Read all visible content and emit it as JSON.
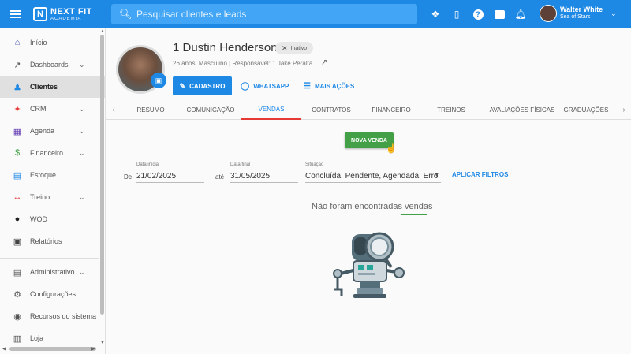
{
  "topbar": {
    "logo_line1": "NEXT FIT",
    "logo_line2": "ACADEMIA",
    "search_placeholder": "Pesquisar clientes e leads",
    "icons": [
      "gift-icon",
      "phone-icon",
      "help-icon",
      "chat-icon",
      "bell-icon"
    ],
    "user_name": "Walter White",
    "user_subtitle": "Sea of Stars"
  },
  "sidebar": {
    "items": [
      {
        "label": "Início",
        "icon": "home-icon"
      },
      {
        "label": "Dashboards",
        "icon": "chart-icon",
        "expandable": true
      },
      {
        "label": "Clientes",
        "icon": "people-icon",
        "active": true
      },
      {
        "label": "CRM",
        "icon": "crm-icon",
        "expandable": true
      },
      {
        "label": "Agenda",
        "icon": "calendar-icon",
        "expandable": true
      },
      {
        "label": "Financeiro",
        "icon": "money-icon",
        "expandable": true
      },
      {
        "label": "Estoque",
        "icon": "cart-icon"
      },
      {
        "label": "Treino",
        "icon": "dumbbell-icon",
        "expandable": true
      },
      {
        "label": "WOD",
        "icon": "kettlebell-icon"
      },
      {
        "label": "Relatórios",
        "icon": "report-icon"
      }
    ],
    "items2": [
      {
        "label": "Administrativo",
        "icon": "admin-icon",
        "expandable": true
      },
      {
        "label": "Configurações",
        "icon": "gear-icon"
      },
      {
        "label": "Recursos do sistema",
        "icon": "toggle-icon"
      },
      {
        "label": "Loja",
        "icon": "shop-icon"
      }
    ]
  },
  "profile": {
    "name": "1 Dustin Henderson",
    "status_badge": "Inativo",
    "meta": "26 anos, Masculino | Responsável: 1 Jake Peralta",
    "btn_cadastro": "CADASTRO",
    "btn_whatsapp": "WHATSAPP",
    "btn_mais_acoes": "MAIS AÇÕES"
  },
  "tabs": [
    "RESUMO",
    "COMUNICAÇÃO",
    "VENDAS",
    "CONTRATOS",
    "FINANCEIRO",
    "TREINOS",
    "AVALIAÇÕES FÍSICAS",
    "GRADUAÇÕES"
  ],
  "active_tab": "VENDAS",
  "vendas": {
    "btn_nova_venda": "NOVA VENDA",
    "de_label": "De",
    "ate_label": "até",
    "data_inicial_label": "Data inicial",
    "data_inicial_value": "21/02/2025",
    "data_final_label": "Data final",
    "data_final_value": "31/05/2025",
    "situacao_label": "Situação",
    "situacao_value": "Concluída, Pendente, Agendada, Erro",
    "btn_aplicar": "APLICAR FILTROS",
    "empty_message": "Não foram encontradas vendas"
  },
  "colors": {
    "primary": "#1e88e5",
    "success": "#43a047",
    "tab_indicator": "#e53935"
  }
}
